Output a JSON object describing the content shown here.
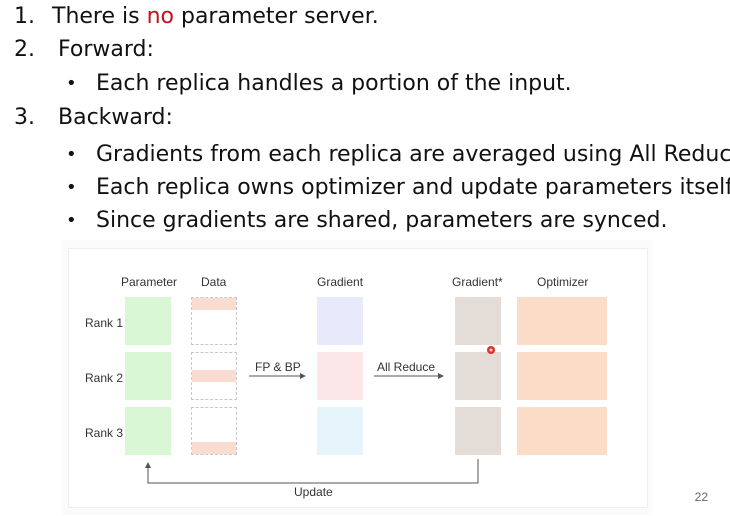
{
  "bullets": {
    "item1": {
      "number": "1.",
      "pre": "There is ",
      "emph": "no",
      "post": " parameter server."
    },
    "item2": {
      "number": "2.",
      "text": "Forward:"
    },
    "item2_sub": [
      "Each replica handles a portion of the input."
    ],
    "item3": {
      "number": "3.",
      "text": "Backward:"
    },
    "item3_sub": [
      "Gradients from each replica are averaged using All Reduce.",
      "Each replica owns optimizer and update parameters itself.",
      "Since gradients are shared, parameters are synced."
    ],
    "bullet_glyph": "•"
  },
  "diagram": {
    "columns": {
      "parameter": "Parameter",
      "data": "Data",
      "gradient": "Gradient",
      "gradient_star": "Gradient*",
      "optimizer": "Optimizer"
    },
    "rows": [
      "Rank 1",
      "Rank 2",
      "Rank 3"
    ],
    "arrow_fp_bp": "FP & BP",
    "arrow_all_reduce": "All Reduce",
    "update_label": "Update",
    "colors": {
      "parameter": "#d9f6d5",
      "data_fill": "#fbdcd0",
      "gradient_rank1": "#e8e9fb",
      "gradient_rank2": "#fbe7e7",
      "gradient_rank3": "#e6f4fb",
      "gradient_star": "#e4dcd6",
      "optimizer": "#fbdcc6",
      "laser_dot": "#e0302c"
    }
  },
  "page_number": "22"
}
